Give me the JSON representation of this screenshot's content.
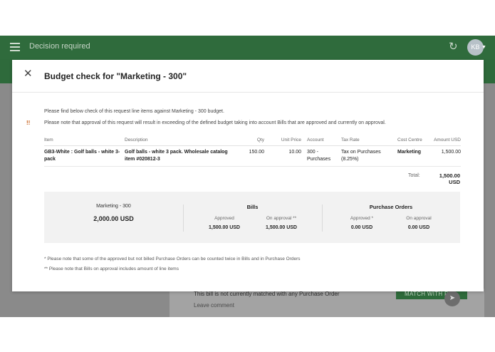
{
  "app": {
    "title": "Decision required",
    "avatar_initials": "KB",
    "background": {
      "match_note": "This bill is not currently matched with any Purchase Order",
      "comment_placeholder": "Leave comment",
      "match_button": "MATCH WITH P"
    }
  },
  "modal": {
    "title": "Budget check for \"Marketing - 300\"",
    "info_line": "Please find below check of this request line items against Marketing - 300 budget.",
    "warning_line": "Please note that approval of this request will result in exceeding of the defined budget taking into account Bills that are approved and currently on approval.",
    "table": {
      "headers": {
        "item": "Item",
        "description": "Description",
        "qty": "Qty",
        "unit_price": "Unit Price",
        "account": "Account",
        "tax_rate": "Tax Rate",
        "cost_centre": "Cost Centre",
        "amount": "Amount USD"
      },
      "rows": [
        {
          "item": "GB3-White : Golf balls - white 3-pack",
          "description": "Golf balls - white 3 pack. Wholesale catalog item #020812-3",
          "qty": "150.00",
          "unit_price": "10.00",
          "account": "300 - Purchases",
          "tax_rate": "Tax on Purchases (8.25%)",
          "cost_centre": "Marketing",
          "amount": "1,500.00"
        }
      ],
      "total_label": "Total:",
      "total_value": "1,500.00 USD"
    },
    "summary": {
      "budget_name": "Marketing - 300",
      "budget_value": "2,000.00 USD",
      "bills": {
        "title": "Bills",
        "approved_label": "Approved",
        "approved_value": "1,500.00 USD",
        "on_approval_label": "On approval **",
        "on_approval_value": "1,500.00 USD"
      },
      "purchase_orders": {
        "title": "Purchase Orders",
        "approved_label": "Approved *",
        "approved_value": "0.00 USD",
        "on_approval_label": "On approval",
        "on_approval_value": "0.00 USD"
      }
    },
    "footnote1": "* Please note that some of the approved but not billed Purchase Orders can be counted twice in Bills and in Purchase Orders",
    "footnote2": "** Please note that Bills on approval includes amount of line items"
  },
  "icons": {
    "menu": "menu-icon",
    "refresh": "refresh-icon",
    "close": "close-icon",
    "warning": "warning-icon",
    "send": "send-icon"
  },
  "colors": {
    "brand_green": "#2f6b3c",
    "warning": "#c8611c"
  }
}
